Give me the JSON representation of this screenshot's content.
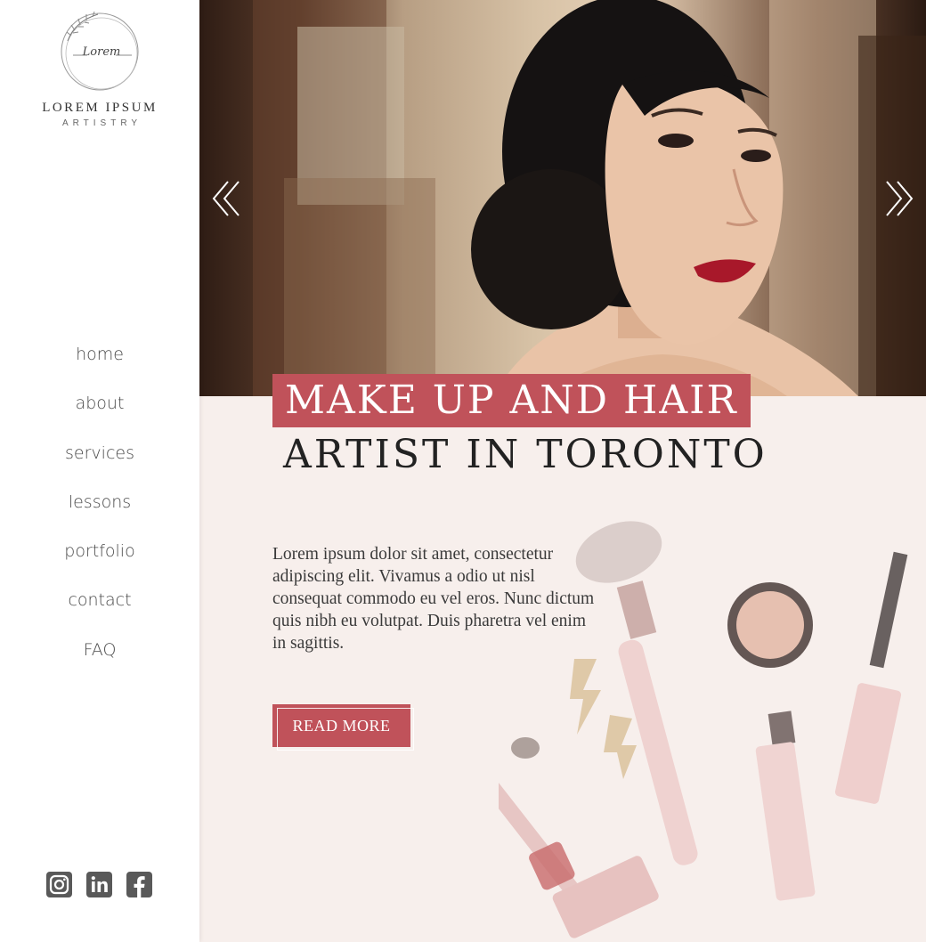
{
  "brand": {
    "logo_script": "Lorem",
    "name": "LOREM IPSUM",
    "tagline": "ARTISTRY"
  },
  "nav": {
    "items": [
      {
        "label": "home"
      },
      {
        "label": "about"
      },
      {
        "label": "services"
      },
      {
        "label": "lessons"
      },
      {
        "label": "portfolio"
      },
      {
        "label": "contact"
      },
      {
        "label": "FAQ"
      }
    ]
  },
  "social": {
    "icons": [
      "instagram-icon",
      "linkedin-icon",
      "facebook-icon"
    ],
    "icon_color": "#595959"
  },
  "hero": {
    "prev_icon": "double-chevron-left-icon",
    "next_icon": "double-chevron-right-icon"
  },
  "headline": {
    "line1": "MAKE UP AND HAIR",
    "line2": "ARTIST IN TORONTO"
  },
  "intro": {
    "text": "Lorem ipsum dolor sit amet, consectetur adipiscing elit. Vivamus a odio ut nisl consequat commodo eu vel eros. Nunc dictum quis nibh eu volutpat. Duis pharetra vel enim in sagittis."
  },
  "cta": {
    "label": "READ MORE"
  },
  "colors": {
    "accent": "#c0525a",
    "background_soft": "#f7efec",
    "text_dark": "#222222"
  }
}
